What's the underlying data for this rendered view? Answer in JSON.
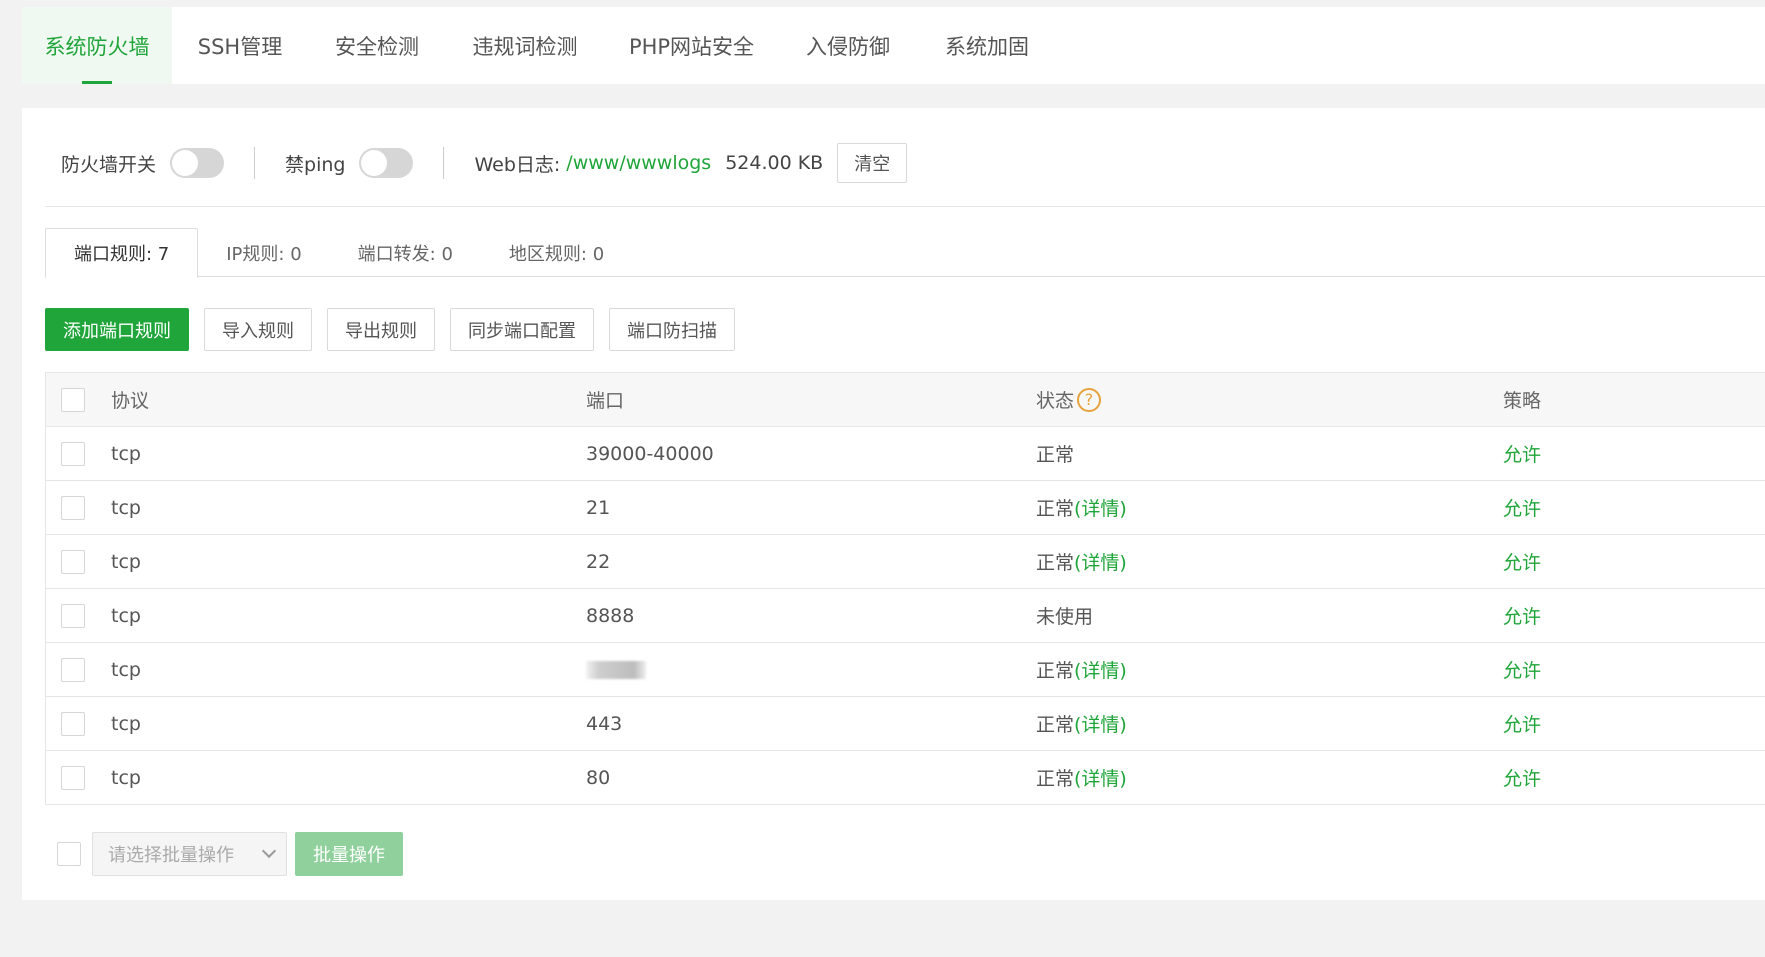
{
  "nav": {
    "tabs": [
      {
        "label": "系统防火墙"
      },
      {
        "label": "SSH管理"
      },
      {
        "label": "安全检测"
      },
      {
        "label": "违规词检测"
      },
      {
        "label": "PHP网站安全"
      },
      {
        "label": "入侵防御"
      },
      {
        "label": "系统加固"
      }
    ]
  },
  "toolbar": {
    "firewall_label": "防火墙开关",
    "ping_label": "禁ping",
    "weblog_label": "Web日志:",
    "weblog_path": "/www/wwwlogs",
    "weblog_size": "524.00 KB",
    "clear_label": "清空"
  },
  "subtabs": [
    {
      "label": "端口规则: 7"
    },
    {
      "label": "IP规则: 0"
    },
    {
      "label": "端口转发: 0"
    },
    {
      "label": "地区规则: 0"
    }
  ],
  "actions": {
    "add": "添加端口规则",
    "import": "导入规则",
    "export": "导出规则",
    "sync": "同步端口配置",
    "scan": "端口防扫描"
  },
  "table": {
    "headers": {
      "protocol": "协议",
      "port": "端口",
      "status": "状态",
      "policy": "策略"
    },
    "rows": [
      {
        "protocol": "tcp",
        "port": "39000-40000",
        "status": "正常",
        "detail": "",
        "policy": "允许"
      },
      {
        "protocol": "tcp",
        "port": "21",
        "status": "正常",
        "detail": "(详情)",
        "policy": "允许"
      },
      {
        "protocol": "tcp",
        "port": "22",
        "status": "正常",
        "detail": "(详情)",
        "policy": "允许"
      },
      {
        "protocol": "tcp",
        "port": "8888",
        "status": "未使用",
        "detail": "",
        "policy": "允许"
      },
      {
        "protocol": "tcp",
        "port": "",
        "status": "正常",
        "detail": "(详情)",
        "policy": "允许"
      },
      {
        "protocol": "tcp",
        "port": "443",
        "status": "正常",
        "detail": "(详情)",
        "policy": "允许"
      },
      {
        "protocol": "tcp",
        "port": "80",
        "status": "正常",
        "detail": "(详情)",
        "policy": "允许"
      }
    ]
  },
  "footer": {
    "select_placeholder": "请选择批量操作",
    "batch_label": "批量操作"
  },
  "colors": {
    "accent": "#20a53a",
    "help": "#e6a23c"
  }
}
